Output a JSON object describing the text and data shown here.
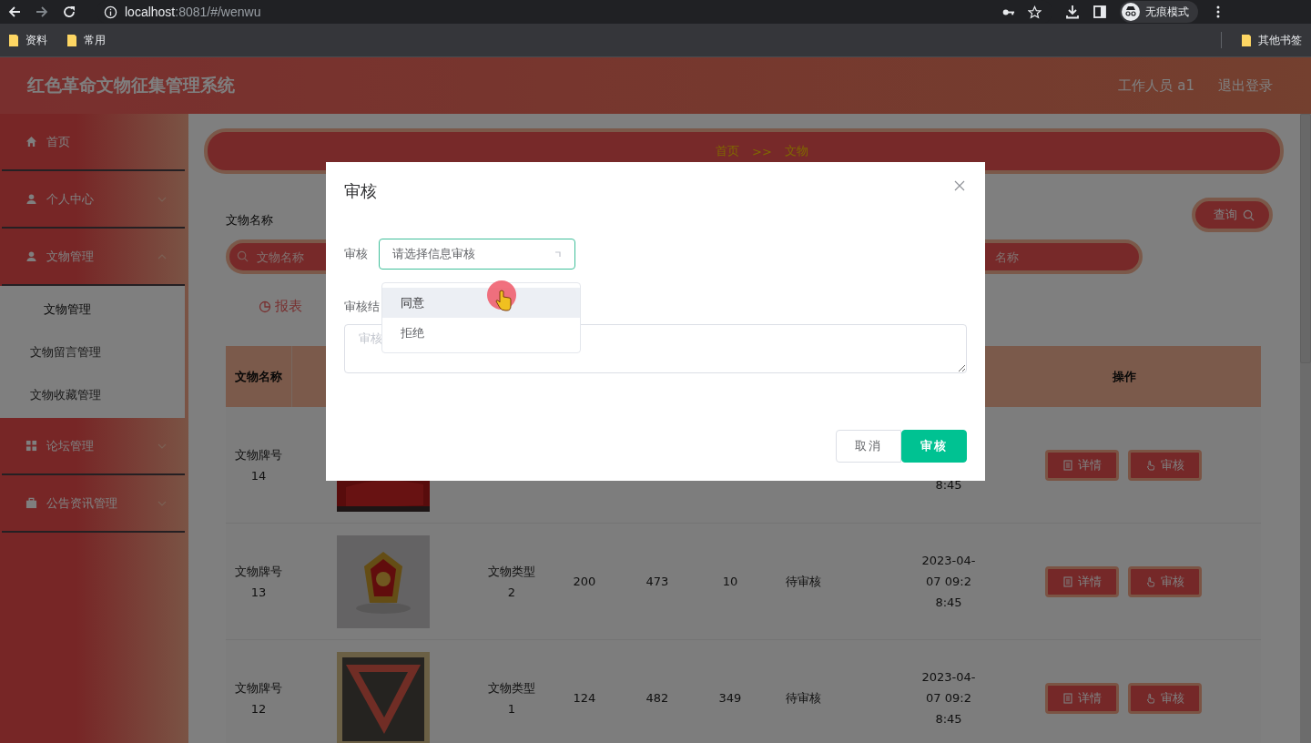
{
  "browser": {
    "url_host": "localhost",
    "url_rest": ":8081/#/wenwu",
    "profile": "无痕模式",
    "bookmarks": [
      "资料",
      "常用"
    ],
    "other_bookmarks": "其他书签"
  },
  "header": {
    "title": "红色革命文物征集管理系统",
    "user": "工作人员 a1",
    "logout": "退出登录"
  },
  "sidebar": {
    "items": [
      {
        "label": "首页"
      },
      {
        "label": "个人中心",
        "expanded": false
      },
      {
        "label": "文物管理",
        "expanded": true,
        "children": [
          {
            "label": "文物管理",
            "selected": true
          },
          {
            "label": "文物留言管理",
            "selected": false
          },
          {
            "label": "文物收藏管理",
            "selected": false
          }
        ]
      },
      {
        "label": "论坛管理",
        "expanded": false
      },
      {
        "label": "公告资讯管理",
        "expanded": false
      }
    ]
  },
  "breadcrumb": {
    "home": "首页",
    "separator": ">>",
    "current": "文物"
  },
  "search": {
    "label": "文物名称",
    "fields": [
      {
        "placeholder": "文物名称"
      },
      {
        "placeholder": "名称"
      }
    ],
    "button": "查询"
  },
  "report_button": "报表",
  "table": {
    "columns": [
      "文物名称",
      "操作"
    ],
    "rows": [
      {
        "name": "文物牌号14",
        "kind": "picture",
        "time": "8:45",
        "actions": [
          "详情",
          "审核"
        ]
      },
      {
        "name": "文物牌号13",
        "kind": "picture",
        "type": "文物类型2",
        "column_4": "200",
        "column_5": "473",
        "column_6": "10",
        "status": "待审核",
        "time": "2023-04-07 09:28:45",
        "actions": [
          "详情",
          "审核"
        ]
      },
      {
        "name": "文物牌号12",
        "kind": "picture",
        "type": "文物类型1",
        "column_4": "124",
        "column_5": "482",
        "column_6": "349",
        "status": "待审核",
        "time": "2023-04-07 09:28:45",
        "actions": [
          "详情",
          "审核"
        ]
      }
    ]
  },
  "dialog": {
    "title": "审核",
    "fields": [
      {
        "kind": "select",
        "label": "审核",
        "placeholder": "请选择信息审核",
        "focused": true
      },
      {
        "kind": "textarea",
        "label": "审核结",
        "placeholder": "审核"
      }
    ],
    "options": [
      {
        "label": "同意",
        "highlighted": true
      },
      {
        "label": "拒绝",
        "highlighted": false
      }
    ],
    "buttons": [
      {
        "kind": "secondary",
        "label": "取消"
      },
      {
        "kind": "primary",
        "label": "审核"
      }
    ]
  }
}
